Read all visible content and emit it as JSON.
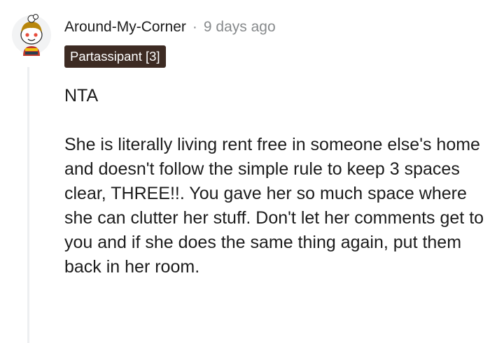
{
  "comment": {
    "author": "Around-My-Corner",
    "separator": "·",
    "timestamp": "9 days ago",
    "flair": "Partassipant [3]",
    "paragraphs": [
      "NTA",
      "She is literally living rent free in someone else's home and doesn't follow the simple rule to keep 3 spaces clear, THREE!!. You gave her so much space where she can clutter her stuff. Don't let her comments get to you and if she does the same thing again, put them back in her room."
    ]
  },
  "colors": {
    "flair_background": "#3d2b23",
    "meta_gray": "#878a8c",
    "thread_line": "#edeff1",
    "text": "#1c1c1c"
  },
  "icons": {
    "avatar": "snoo-avatar"
  }
}
